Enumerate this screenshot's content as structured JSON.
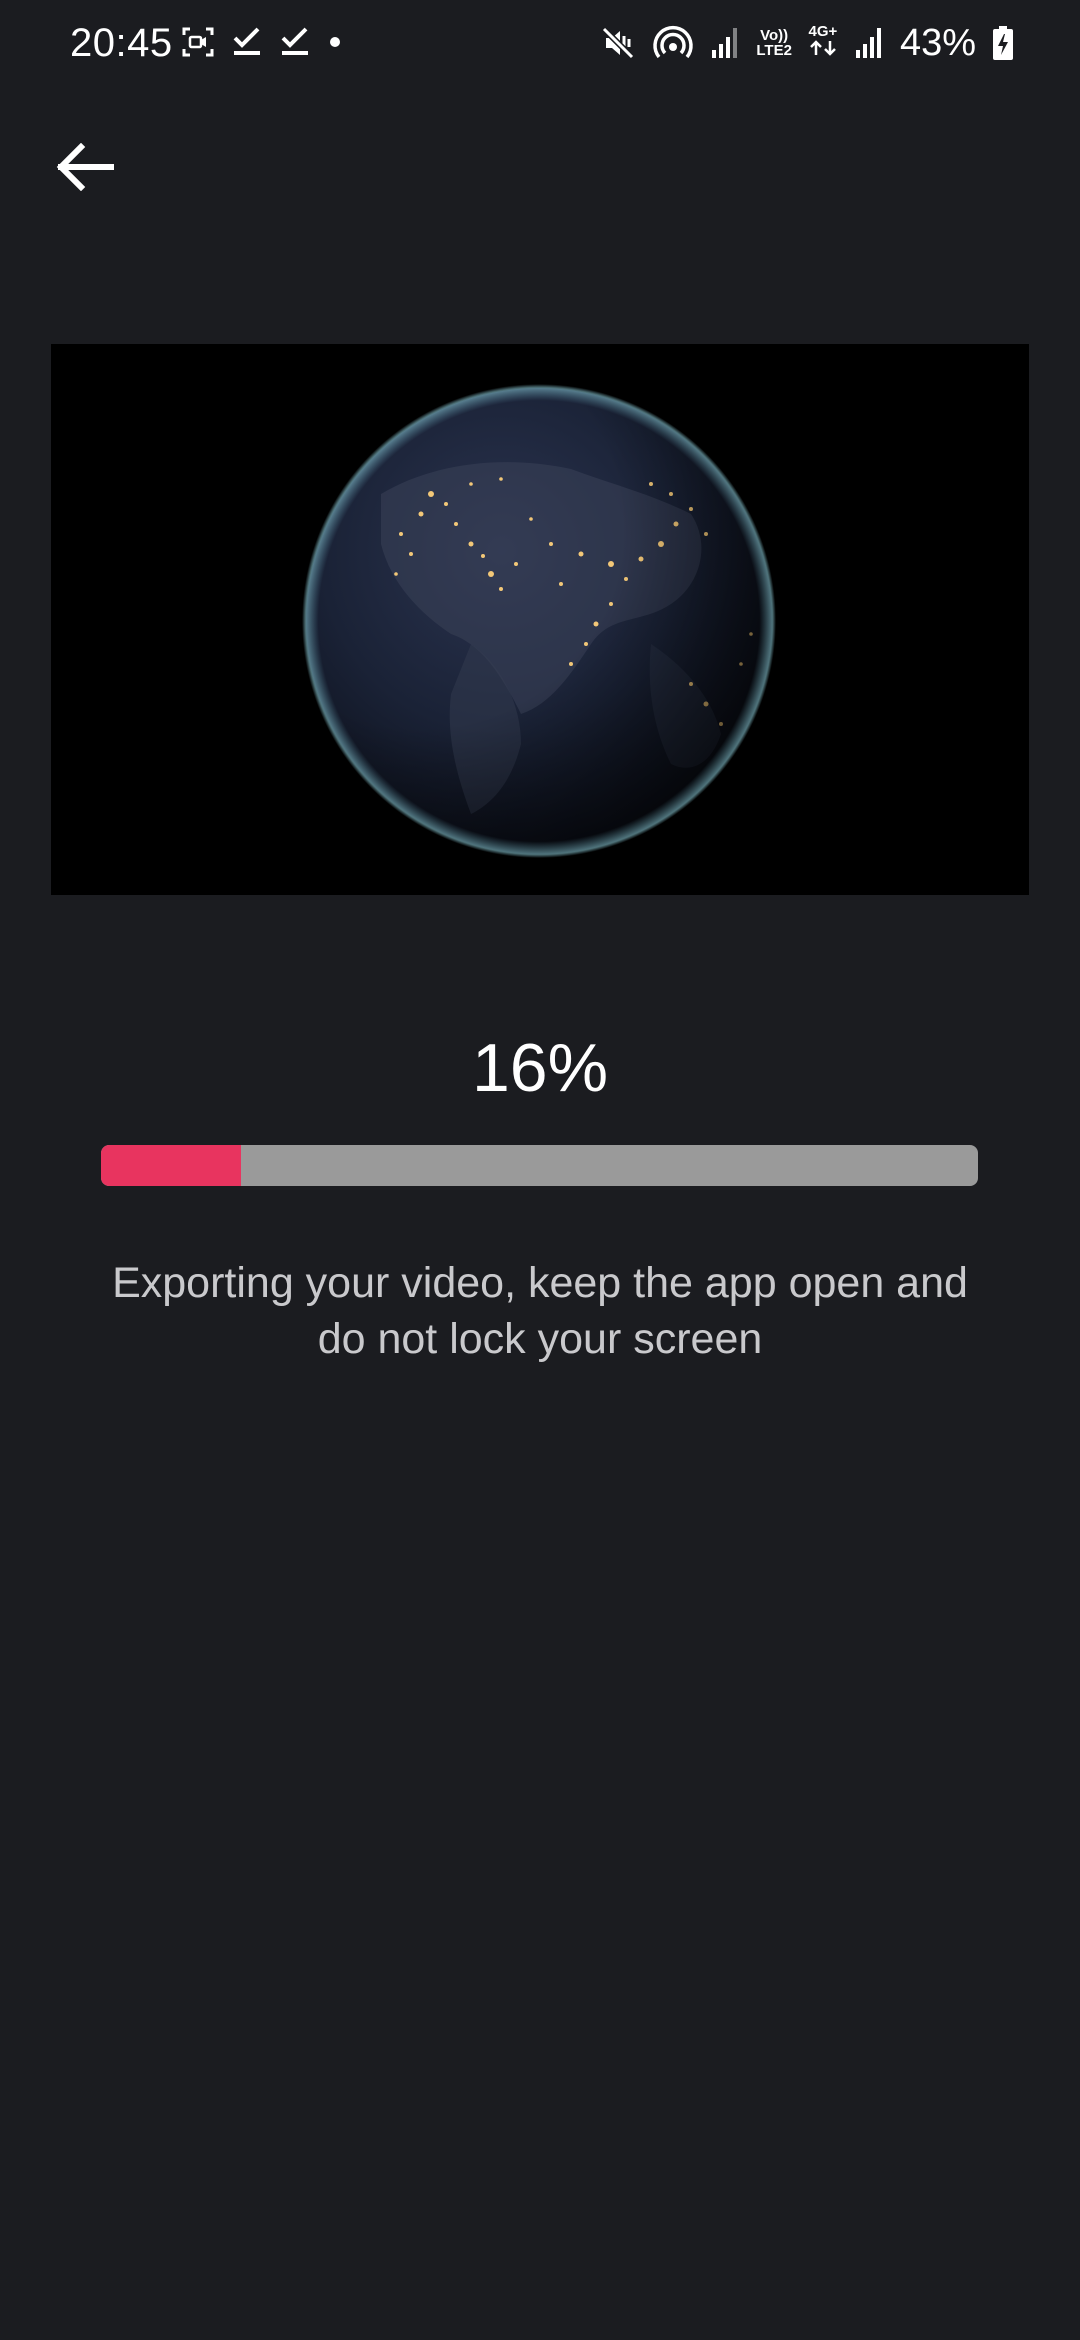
{
  "status_bar": {
    "time": "20:45",
    "left_icons": [
      "screen-record-icon",
      "check-icon",
      "check-icon",
      "dot-icon"
    ],
    "right_icons": [
      "mute-vibrate-icon",
      "hotspot-icon",
      "signal-icon",
      "volte-icon",
      "network-4g-icon",
      "signal-icon",
      "battery-charging-icon"
    ],
    "volte_label_top": "Vo))",
    "volte_label_bottom": "LTE2",
    "network_label": "4G+",
    "battery_percent": "43%"
  },
  "nav": {
    "back_icon": "arrow-left-icon"
  },
  "preview": {
    "content": "earth-at-night-image"
  },
  "progress": {
    "percent_label": "16%",
    "value": 0.16,
    "fill_color": "#e8345f",
    "track_color": "#9a9a9a"
  },
  "message": {
    "text": "Exporting your video, keep the app open and do not lock your screen"
  },
  "colors": {
    "background": "#1b1c20",
    "accent": "#e8345f"
  }
}
